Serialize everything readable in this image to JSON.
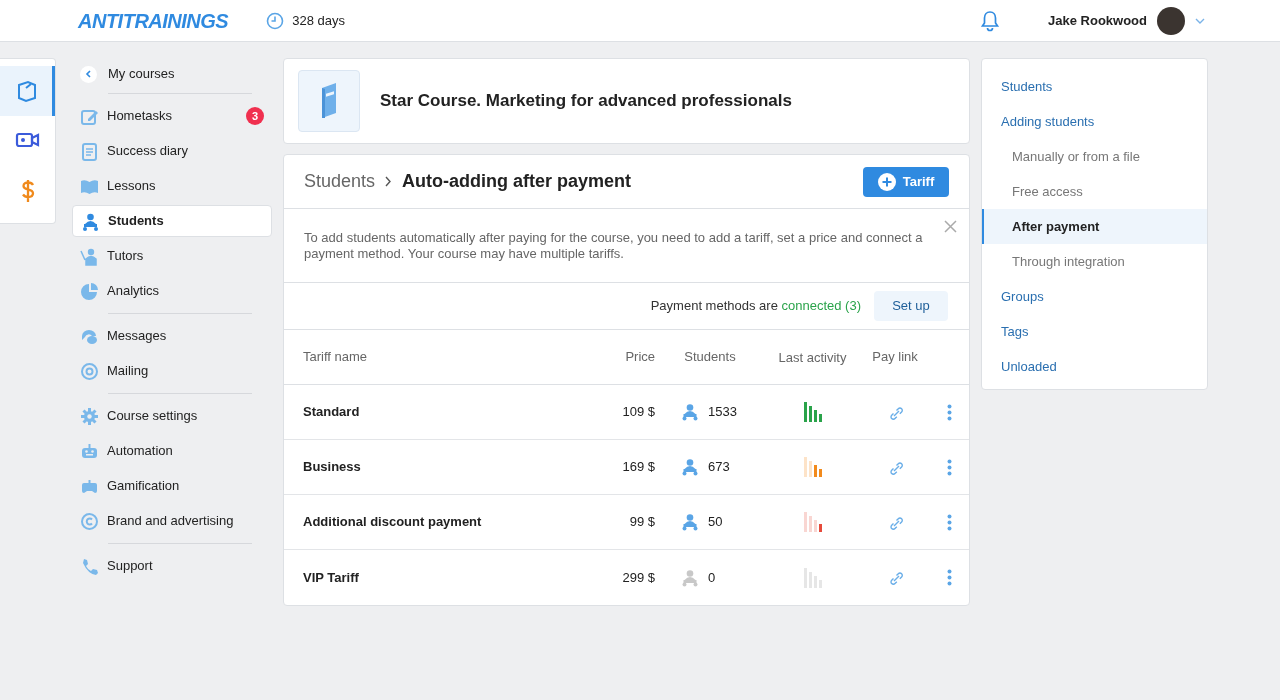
{
  "header": {
    "logo": "ANTITRAININGS",
    "days": "328 days",
    "user_name": "Jake Rookwood"
  },
  "rail": [
    {
      "selected": true
    },
    {
      "selected": false
    },
    {
      "selected": false
    }
  ],
  "sidebar": {
    "back": "My courses",
    "groups": [
      [
        {
          "label": "Hometasks",
          "selected": false,
          "badge": "3"
        },
        {
          "label": "Success diary",
          "selected": false
        },
        {
          "label": "Lessons",
          "selected": false
        },
        {
          "label": "Students",
          "selected": true
        },
        {
          "label": "Tutors",
          "selected": false
        },
        {
          "label": "Analytics",
          "selected": false
        }
      ],
      [
        {
          "label": "Messages",
          "selected": false
        },
        {
          "label": "Mailing",
          "selected": false
        }
      ],
      [
        {
          "label": "Course settings",
          "selected": false
        },
        {
          "label": "Automation",
          "selected": false
        },
        {
          "label": "Gamification",
          "selected": false
        },
        {
          "label": "Brand and advertising",
          "selected": false
        }
      ],
      [
        {
          "label": "Support",
          "selected": false
        }
      ]
    ]
  },
  "course": {
    "title": "Star Course. Marketing for advanced professionals"
  },
  "panel": {
    "breadcrumb": "Students",
    "title": "Auto-adding after payment",
    "add_button": "Tariff",
    "notice": "To add students automatically after paying for the course, you need to add a tariff, set a price and connect a payment method. Your course may have multiple tariffs.",
    "payment_text": "Payment methods are",
    "payment_status": "connected (3)",
    "setup_button": "Set up",
    "columns": [
      "Tariff name",
      "Price",
      "Students",
      "Last activity",
      "Pay link"
    ],
    "rows": [
      {
        "name": "Standard",
        "price": "109 $",
        "students": "1533",
        "kind": "high"
      },
      {
        "name": "Business",
        "price": "169 $",
        "students": "673",
        "kind": "medium"
      },
      {
        "name": "Additional discount payment",
        "price": "99 $",
        "students": "50",
        "kind": "low"
      },
      {
        "name": "VIP Tariff",
        "price": "299 $",
        "students": "0",
        "kind": "none"
      }
    ]
  },
  "right_nav": [
    {
      "label": "Students",
      "selected": false
    },
    {
      "label": "Adding students",
      "selected": false,
      "children": [
        {
          "label": "Manually or from a file",
          "selected": false
        },
        {
          "label": "Free access",
          "selected": false
        },
        {
          "label": "After payment",
          "selected": true
        },
        {
          "label": "Through integration",
          "selected": false
        }
      ]
    },
    {
      "label": "Groups",
      "selected": false
    },
    {
      "label": "Tags",
      "selected": false
    },
    {
      "label": "Unloaded",
      "selected": false
    }
  ]
}
